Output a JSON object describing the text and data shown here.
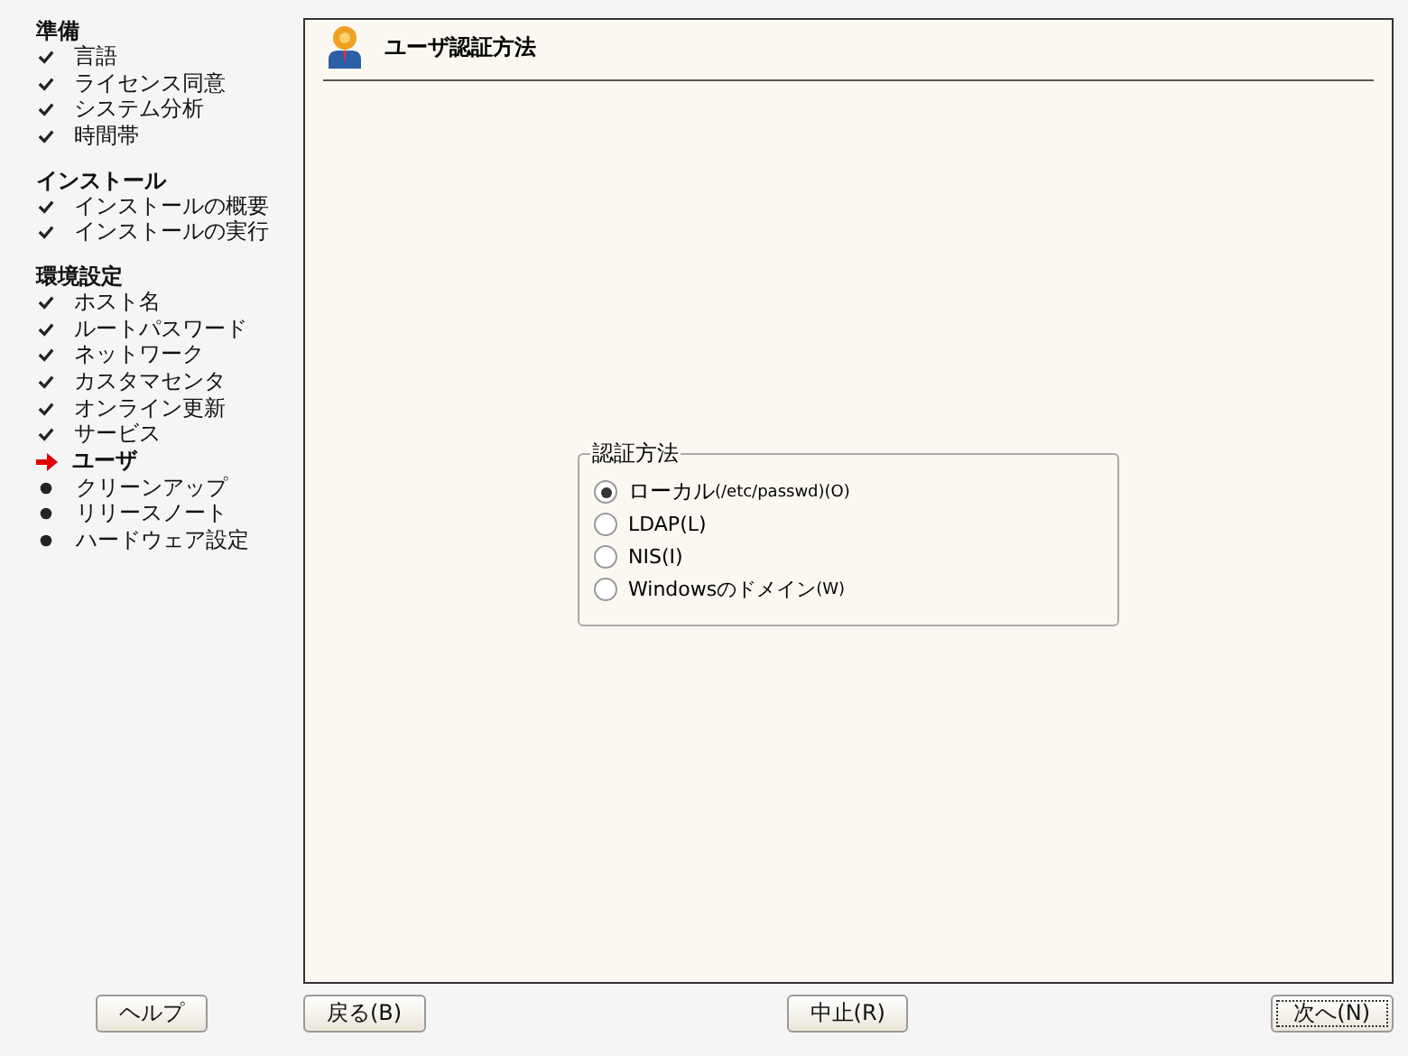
{
  "sidebar": {
    "sections": [
      {
        "title": "準備",
        "steps": [
          {
            "label": "言語",
            "kind": "done"
          },
          {
            "label": "ライセンス同意",
            "kind": "done"
          },
          {
            "label": "システム分析",
            "kind": "done"
          },
          {
            "label": "時間帯",
            "kind": "done"
          }
        ]
      },
      {
        "title": "インストール",
        "steps": [
          {
            "label": "インストールの概要",
            "kind": "done"
          },
          {
            "label": "インストールの実行",
            "kind": "done"
          }
        ]
      },
      {
        "title": "環境設定",
        "steps": [
          {
            "label": "ホスト名",
            "kind": "done"
          },
          {
            "label": "ルートパスワード",
            "kind": "done"
          },
          {
            "label": "ネットワーク",
            "kind": "done"
          },
          {
            "label": "カスタマセンタ",
            "kind": "done"
          },
          {
            "label": "オンライン更新",
            "kind": "done"
          },
          {
            "label": "サービス",
            "kind": "done"
          },
          {
            "label": "ユーザ",
            "kind": "current"
          },
          {
            "label": "クリーンアップ",
            "kind": "pending"
          },
          {
            "label": "リリースノート",
            "kind": "pending"
          },
          {
            "label": "ハードウェア設定",
            "kind": "pending"
          }
        ]
      }
    ]
  },
  "page": {
    "title": "ユーザ認証方法",
    "group": {
      "legend": "認証方法",
      "options": [
        {
          "label": "ローカル",
          "detail": "(/etc/passwd)(O)",
          "selected": true
        },
        {
          "label": "LDAP(L)",
          "selected": false
        },
        {
          "label": "NIS(I)",
          "selected": false
        },
        {
          "label": "Windowsのドメイン",
          "detail": "(W)",
          "selected": false
        }
      ]
    }
  },
  "buttons": {
    "help": "ヘルプ",
    "back": "戻る(B)",
    "abort": "中止(R)",
    "next": "次へ(N)"
  }
}
